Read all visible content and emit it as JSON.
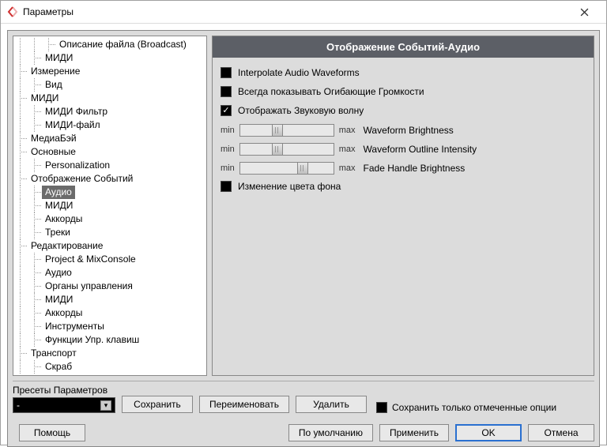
{
  "window": {
    "title": "Параметры"
  },
  "content": {
    "header": "Отображение Событий-Аудио",
    "checkbox1": {
      "label": "Interpolate Audio Waveforms",
      "checked": false
    },
    "checkbox2": {
      "label": "Всегда показывать Огибающие Громкости",
      "checked": false
    },
    "checkbox3": {
      "label": "Отображать Звуковую волну",
      "checked": true
    },
    "slider1": {
      "min": "min",
      "max": "max",
      "label": "Waveform Brightness",
      "pos": 40
    },
    "slider2": {
      "min": "min",
      "max": "max",
      "label": "Waveform Outline Intensity",
      "pos": 40
    },
    "slider3": {
      "min": "min",
      "max": "max",
      "label": "Fade Handle Brightness",
      "pos": 72
    },
    "checkbox4": {
      "label": "Изменение цвета фона",
      "checked": false
    }
  },
  "tree": [
    {
      "label": "Описание файла (Broadcast)",
      "depth": 3
    },
    {
      "label": "МИДИ",
      "depth": 2
    },
    {
      "label": "Измерение",
      "depth": 1
    },
    {
      "label": "Вид",
      "depth": 2
    },
    {
      "label": "МИДИ",
      "depth": 1
    },
    {
      "label": "МИДИ Фильтр",
      "depth": 2
    },
    {
      "label": "МИДИ-файл",
      "depth": 2
    },
    {
      "label": "МедиаБэй",
      "depth": 1
    },
    {
      "label": "Основные",
      "depth": 1
    },
    {
      "label": "Personalization",
      "depth": 2
    },
    {
      "label": "Отображение Событий",
      "depth": 1
    },
    {
      "label": "Аудио",
      "depth": 2,
      "selected": true
    },
    {
      "label": "МИДИ",
      "depth": 2
    },
    {
      "label": "Аккорды",
      "depth": 2
    },
    {
      "label": "Треки",
      "depth": 2
    },
    {
      "label": "Редактирование",
      "depth": 1
    },
    {
      "label": "Project & MixConsole",
      "depth": 2
    },
    {
      "label": "Аудио",
      "depth": 2
    },
    {
      "label": "Органы управления",
      "depth": 2
    },
    {
      "label": "МИДИ",
      "depth": 2
    },
    {
      "label": "Аккорды",
      "depth": 2
    },
    {
      "label": "Инструменты",
      "depth": 2
    },
    {
      "label": "Функции Упр. клавиш",
      "depth": 2
    },
    {
      "label": "Транспорт",
      "depth": 1
    },
    {
      "label": "Скраб",
      "depth": 2
    }
  ],
  "presets": {
    "label": "Пресеты Параметров",
    "selected": "-",
    "save": "Сохранить",
    "rename": "Переименовать",
    "delete": "Удалить",
    "saveMarked": "Сохранить только отмеченные опции"
  },
  "footer": {
    "help": "Помощь",
    "defaults": "По умолчанию",
    "apply": "Применить",
    "ok": "OK",
    "cancel": "Отмена"
  }
}
